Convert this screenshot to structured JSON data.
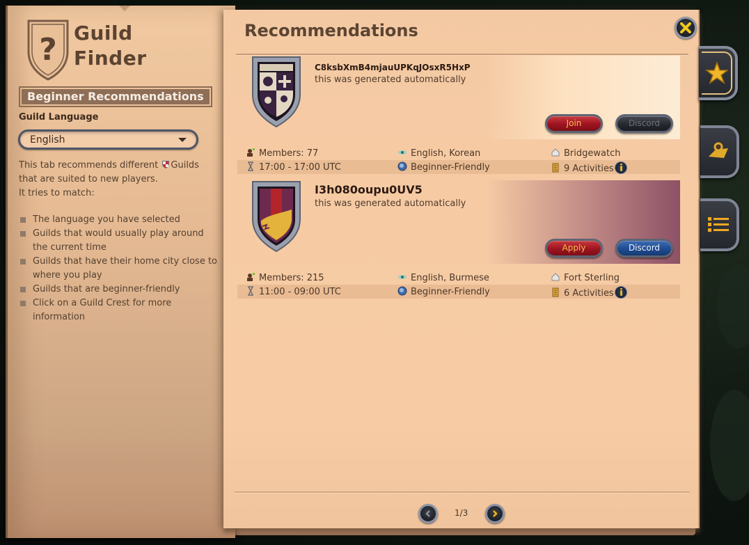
{
  "sidebar": {
    "logo_icon": "question-shield-icon",
    "title_line1": "Guild",
    "title_line2": "Finder",
    "section": "Beginner Recommendations",
    "language_label": "Guild Language",
    "language_selected": "English",
    "description_part1": "This tab recommends different",
    "description_guilds": "Guilds",
    "description_part2": "that are suited to new players.",
    "description_part3": "It tries to match:",
    "bullets": [
      "The language you have selected",
      "Guilds that would usually play around the current time",
      "Guilds that have their home city close to where you play",
      "Guilds that are beginner-friendly",
      "Click on a Guild Crest for more information"
    ]
  },
  "main": {
    "title": "Recommendations",
    "close_icon": "close-x-icon",
    "guilds": [
      {
        "name": "C8ksbXmB4mjauUPKqJOsxR5HxP",
        "description": "this was generated automatically",
        "primary_button": "Join",
        "discord_button": "Discord",
        "discord_enabled": false,
        "members": "Members: 77",
        "languages": "English, Korean",
        "city": "Bridgewatch",
        "time": "17:00 - 17:00 UTC",
        "tag": "Beginner-Friendly",
        "activities": "9 Activities",
        "banner_color": "#fdecd5"
      },
      {
        "name": "I3h080oupu0UV5",
        "description": "this was generated automatically",
        "primary_button": "Apply",
        "discord_button": "Discord",
        "discord_enabled": true,
        "members": "Members: 215",
        "languages": "English, Burmese",
        "city": "Fort Sterling",
        "time": "11:00 - 09:00 UTC",
        "tag": "Beginner-Friendly",
        "activities": "6 Activities",
        "banner_color": "#8d5166"
      }
    ],
    "pagination": {
      "current": 1,
      "total": 3,
      "label": "1/3"
    }
  },
  "side_tabs": [
    {
      "icon": "star-icon",
      "active": true
    },
    {
      "icon": "map-scroll-icon",
      "active": false
    },
    {
      "icon": "list-icon",
      "active": false
    }
  ],
  "colors": {
    "parchment": "#f7cca5",
    "title_text": "#5c4533",
    "accent_gold": "#e4b62c",
    "button_red": "#9d1420",
    "button_blue": "#1f4c91"
  }
}
